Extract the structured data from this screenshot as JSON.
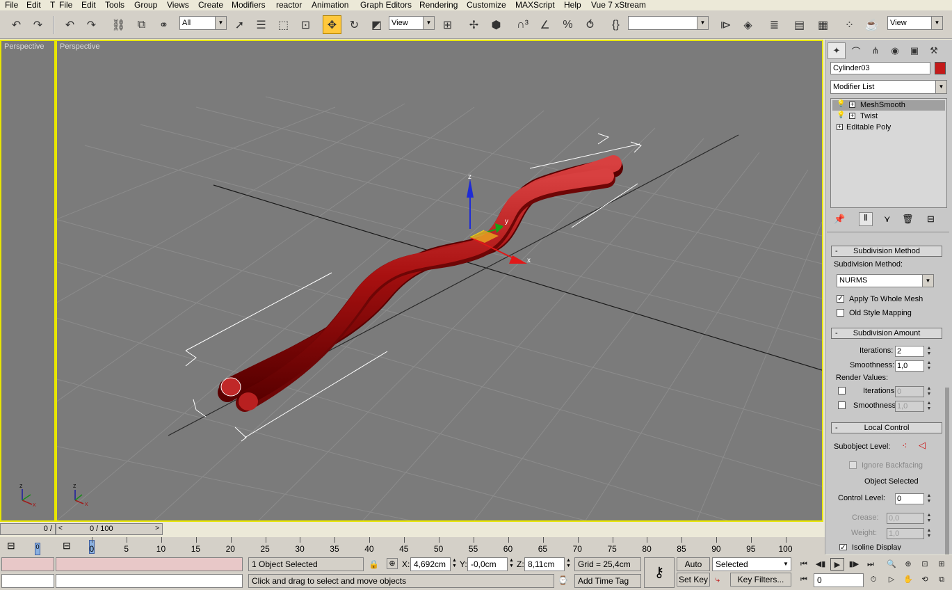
{
  "menubar": {
    "items": [
      "File",
      "Edit",
      "T",
      "File",
      "Edit",
      "Tools",
      "Group",
      "Views",
      "Create",
      "Modifiers",
      "reactor",
      "Animation",
      "Graph Editors",
      "Rendering",
      "Customize",
      "MAXScript",
      "Help",
      "Vue 7 xStream"
    ]
  },
  "toolbar": {
    "selection_filter": "All",
    "ref_coord": "View",
    "named_sel": "",
    "view_dropdown": "View"
  },
  "viewports": {
    "left_label": "Perspective",
    "main_label": "Perspective",
    "gizmo_x": "x",
    "gizmo_y": "y",
    "gizmo_z": "z"
  },
  "command_panel": {
    "object_name": "Cylinder03",
    "object_color": "#c41a1a",
    "modifier_list_label": "Modifier List",
    "stack": [
      "MeshSmooth",
      "Twist",
      "Editable Poly"
    ],
    "subdivision_method": {
      "title": "Subdivision Method",
      "method_label": "Subdivision Method:",
      "method_value": "NURMS",
      "apply_whole_mesh": "Apply To Whole Mesh",
      "old_style_mapping": "Old Style Mapping"
    },
    "subdivision_amount": {
      "title": "Subdivision Amount",
      "iterations_label": "Iterations:",
      "iterations_value": "2",
      "smoothness_label": "Smoothness:",
      "smoothness_value": "1,0",
      "render_values_label": "Render Values:",
      "r_iterations_label": "Iterations:",
      "r_iterations_value": "0",
      "r_smoothness_label": "Smoothness:",
      "r_smoothness_value": "1,0"
    },
    "local_control": {
      "title": "Local Control",
      "subobject_label": "Subobject Level:",
      "ignore_backfacing": "Ignore Backfacing",
      "object_selected": "Object Selected",
      "control_level_label": "Control Level:",
      "control_level_value": "0",
      "crease_label": "Crease:",
      "crease_value": "0,0",
      "weight_label": "Weight:",
      "weight_value": "1,0",
      "isoline_label": "Isoline Display"
    }
  },
  "timeline": {
    "left_counter": "0 /",
    "slider_value": "0 / 100",
    "ticks": [
      "0",
      "5",
      "10",
      "15",
      "20",
      "25",
      "30",
      "35",
      "40",
      "45",
      "50",
      "55",
      "60",
      "65",
      "70",
      "75",
      "80",
      "85",
      "90",
      "95",
      "100"
    ],
    "left_tick": "0"
  },
  "status": {
    "selection": "1 Object Selected",
    "prompt": "Click and drag to select and move objects",
    "x_label": "X:",
    "x_value": "4,692cm",
    "y_label": "Y:",
    "y_value": "-0,0cm",
    "z_label": "Z:",
    "z_value": "8,11cm",
    "grid": "Grid = 25,4cm",
    "add_time_tag": "Add Time Tag",
    "auto_key": "Auto Key",
    "set_key": "Set Key",
    "key_mode": "Selected",
    "key_filters": "Key Filters...",
    "frame_value": "0"
  }
}
